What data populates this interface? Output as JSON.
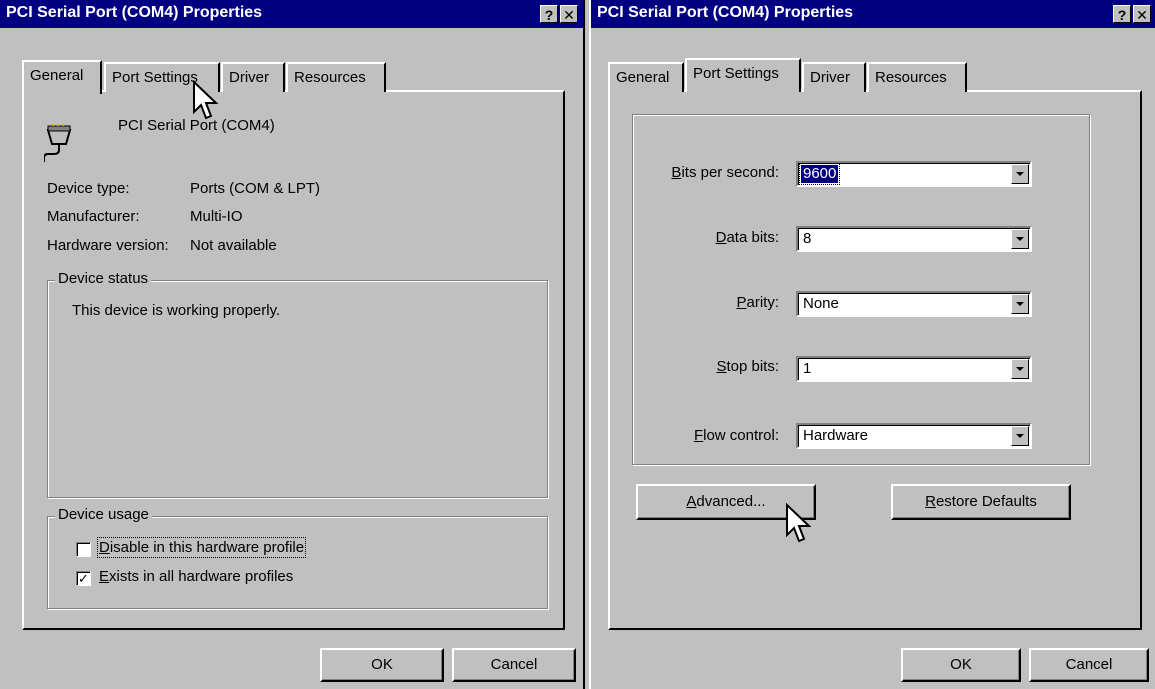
{
  "left": {
    "title": "PCI Serial Port (COM4) Properties",
    "help_btn": "?",
    "close_btn": "✕",
    "tabs": [
      "General",
      "Port Settings",
      "Driver",
      "Resources"
    ],
    "device_name": "PCI Serial Port (COM4)",
    "device_type_label": "Device type:",
    "device_type_value": "Ports (COM & LPT)",
    "manufacturer_label": "Manufacturer:",
    "manufacturer_value": "Multi-IO",
    "hw_version_label": "Hardware version:",
    "hw_version_value": "Not available",
    "device_status_legend": "Device status",
    "device_status_text": "This device is working properly.",
    "device_usage_legend": "Device usage",
    "disable_first": "D",
    "disable_rest": "isable in this hardware profile",
    "disable_checked": false,
    "exists_first": "E",
    "exists_rest": "xists in all hardware profiles",
    "exists_checked": true,
    "ok": "OK",
    "cancel": "Cancel"
  },
  "right": {
    "title": "PCI Serial Port (COM4) Properties",
    "help_btn": "?",
    "close_btn": "✕",
    "tabs": [
      "General",
      "Port Settings",
      "Driver",
      "Resources"
    ],
    "fields": [
      {
        "ul": "B",
        "rest": "its per second:",
        "value": "9600",
        "selected": true
      },
      {
        "ul": "D",
        "rest": "ata bits:",
        "value": "8",
        "selected": false
      },
      {
        "ul": "P",
        "rest": "arity:",
        "value": "None",
        "selected": false
      },
      {
        "ul": "S",
        "rest": "top bits:",
        "value": "1",
        "selected": false
      },
      {
        "ul": "F",
        "rest": "low control:",
        "value": "Hardware",
        "selected": false
      }
    ],
    "advanced_ul": "A",
    "advanced_rest": "dvanced...",
    "restore_ul": "R",
    "restore_rest": "estore Defaults",
    "ok": "OK",
    "cancel": "Cancel"
  }
}
